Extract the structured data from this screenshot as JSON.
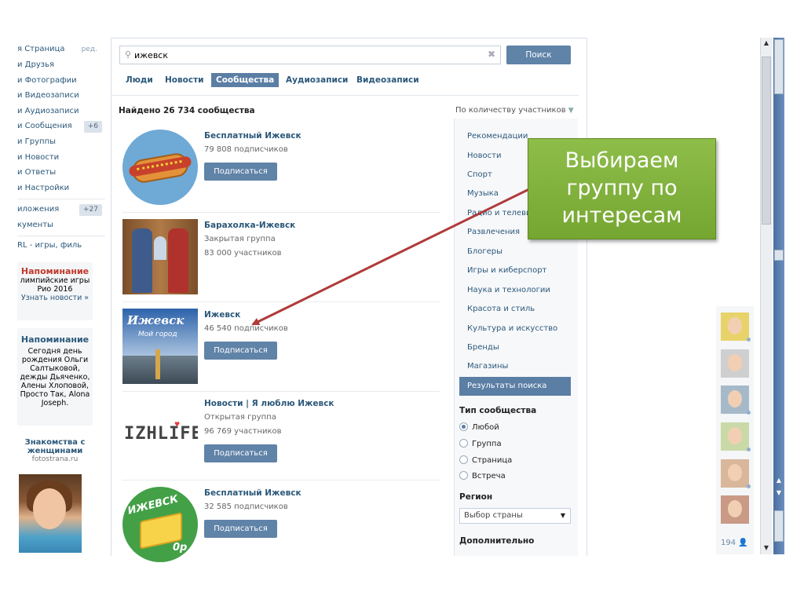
{
  "left_menu": {
    "edit_label": "ред.",
    "items": [
      {
        "label": "я Страница"
      },
      {
        "label": "и Друзья"
      },
      {
        "label": "и Фотографии"
      },
      {
        "label": "и Видеозаписи"
      },
      {
        "label": "и Аудиозаписи"
      },
      {
        "label": "и Сообщения",
        "badge": "+6"
      },
      {
        "label": "и Группы"
      },
      {
        "label": "и Новости"
      },
      {
        "label": "и Ответы"
      },
      {
        "label": "и Настройки"
      },
      {
        "label": "иложения",
        "badge": "+27"
      },
      {
        "label": "кументы"
      },
      {
        "label": "RL - игры, филь"
      }
    ]
  },
  "ads": [
    {
      "title": "Напоминание",
      "lines": [
        "лимпийские игры",
        "Рио 2016"
      ],
      "link": "Узнать новости »"
    },
    {
      "title": "Напоминание",
      "lines": [
        "Сегодня день",
        "рождения Ольги",
        "Салтыковой,",
        "дежды Дьяченко,",
        "Алены Хлоповой,",
        "Просто Так, Alona",
        "Joseph."
      ]
    }
  ],
  "fotostrana": {
    "title": "Знакомства с женщинами",
    "site": "fotostrana.ru"
  },
  "search": {
    "query": "ижевск",
    "button": "Поиск",
    "tabs": [
      "Люди",
      "Новости",
      "Сообщества",
      "Аудиозаписи",
      "Видеозаписи"
    ],
    "active_tab": "Сообщества"
  },
  "results": {
    "found_label": "Найдено 26 734 сообщества",
    "sort_label": "По количеству участников",
    "groups": [
      {
        "name": "Бесплатный Ижевск",
        "type": "",
        "count": "79 808 подписчиков",
        "button": "Подписаться"
      },
      {
        "name": "Барахолка-Ижевск",
        "type": "Закрытая группа",
        "count": "83 000 участников",
        "button": ""
      },
      {
        "name": "Ижевск",
        "type": "",
        "count": "46 540 подписчиков",
        "button": "Подписаться",
        "thumb_title": "Ижевск",
        "thumb_sub": "Мой город"
      },
      {
        "name": "Новости | Я люблю Ижевск",
        "type": "Открытая группа",
        "count": "96 769 участников",
        "button": "Подписаться",
        "thumb_logo": "IZHLIFE"
      },
      {
        "name": "Бесплатный Ижевск",
        "type": "",
        "count": "32 585 подписчиков",
        "button": "Подписаться",
        "thumb_banner": "ИЖЕВСК",
        "thumb_price": "0р"
      }
    ]
  },
  "filters": {
    "categories": [
      "Рекомендации",
      "Новости",
      "Спорт",
      "Музыка",
      "Радио и телевидение",
      "Развлечения",
      "Блогеры",
      "Игры и киберспорт",
      "Наука и технологии",
      "Красота и стиль",
      "Культура и искусство",
      "Бренды",
      "Магазины",
      "Результаты поиска"
    ],
    "active_category": "Результаты поиска",
    "type_heading": "Тип сообщества",
    "types": [
      "Любой",
      "Группа",
      "Страница",
      "Встреча"
    ],
    "selected_type": "Любой",
    "region_heading": "Регион",
    "region_select": "Выбор страны",
    "extra_heading": "Дополнительно"
  },
  "callout": {
    "lines": [
      "Выбираем",
      "группу по",
      "интересам"
    ],
    "color": "#7fae3a"
  },
  "friends": {
    "count": "194"
  },
  "colors": {
    "accent": "#5b7ea4",
    "link": "#2b587a",
    "arrow": "#b03a3a"
  }
}
